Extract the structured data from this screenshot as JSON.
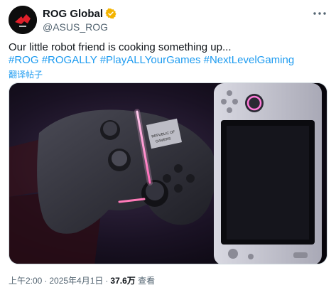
{
  "author": {
    "display_name": "ROG Global",
    "handle": "@ASUS_ROG",
    "verified": true
  },
  "tweet": {
    "text": "Our little robot friend is cooking something up...",
    "hashtags": [
      "#ROG",
      "#ROGALLY",
      "#PlayALLYourGames",
      "#NextLevelGaming"
    ],
    "translate_label": "翻译帖子"
  },
  "media": {
    "shirt_text_line1": "REPUBLIC OF",
    "shirt_text_line2": "GAMERS"
  },
  "meta": {
    "time": "上午2:00",
    "separator": "·",
    "date": "2025年4月1日",
    "views_count": "37.6万",
    "views_label": "查看"
  },
  "colors": {
    "link": "#1d9bf0",
    "secondary_text": "#536471",
    "primary_text": "#0f1419",
    "verified_badge": "#f4b400",
    "accent_glow": "#ff6ec7"
  },
  "icons": {
    "verified": "verified-badge-icon",
    "more": "more-dots-icon",
    "avatar": "rog-logo-icon"
  }
}
